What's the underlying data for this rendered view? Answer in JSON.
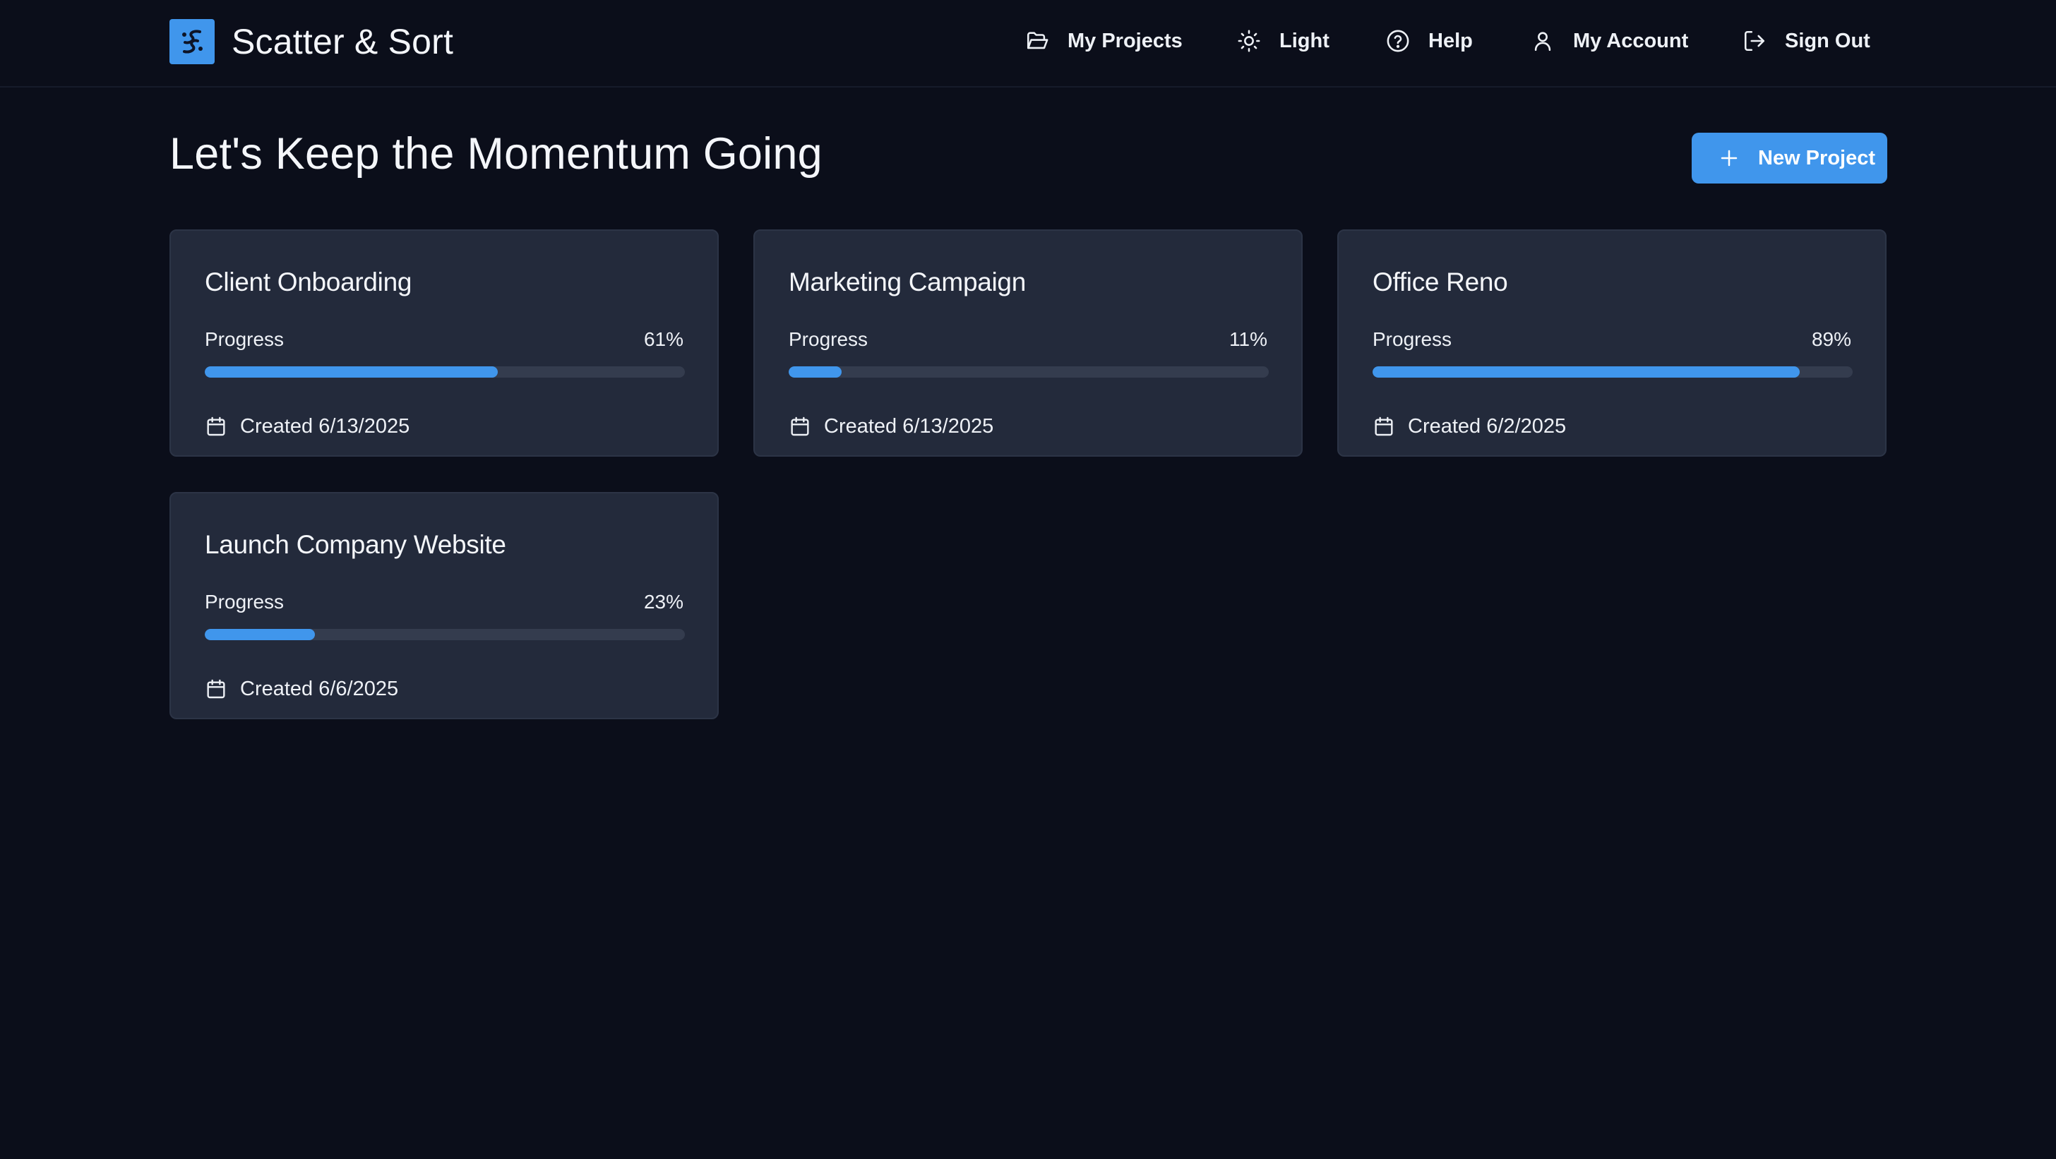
{
  "app": {
    "name": "Scatter & Sort"
  },
  "nav": {
    "my_projects": "My Projects",
    "theme": "Light",
    "help": "Help",
    "account": "My Account",
    "sign_out": "Sign Out"
  },
  "page": {
    "heading": "Let's Keep the Momentum Going",
    "new_project_label": "New Project"
  },
  "projects": [
    {
      "title": "Client Onboarding",
      "progress_label": "Progress",
      "progress_text": "61%",
      "progress": 61,
      "created": "Created 6/13/2025"
    },
    {
      "title": "Marketing Campaign",
      "progress_label": "Progress",
      "progress_text": "11%",
      "progress": 11,
      "created": "Created 6/13/2025"
    },
    {
      "title": "Office Reno",
      "progress_label": "Progress",
      "progress_text": "89%",
      "progress": 89,
      "created": "Created 6/2/2025"
    },
    {
      "title": "Launch Company Website",
      "progress_label": "Progress",
      "progress_text": "23%",
      "progress": 23,
      "created": "Created 6/6/2025"
    }
  ],
  "colors": {
    "background": "#0b0e1a",
    "card": "#232a3b",
    "accent": "#4096ec",
    "track": "#343c4e"
  },
  "icons": {
    "logo": "scatter-sort-logo-icon",
    "my_projects": "folder-open-icon",
    "theme": "sun-icon",
    "help": "help-circle-icon",
    "account": "user-icon",
    "sign_out": "log-out-icon",
    "new_project": "plus-icon",
    "created": "calendar-icon"
  }
}
